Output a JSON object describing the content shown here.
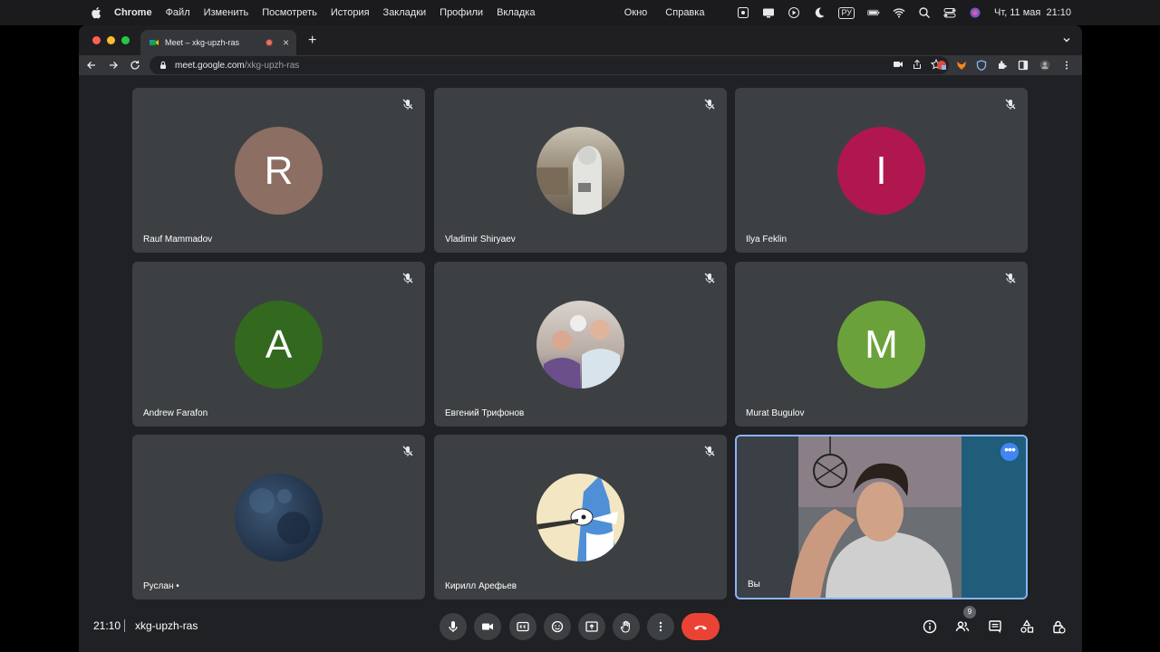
{
  "menubar": {
    "app": "Chrome",
    "items": [
      "Файл",
      "Изменить",
      "Посмотреть",
      "История",
      "Закладки",
      "Профили",
      "Вкладка"
    ],
    "right_items": [
      "Окно",
      "Справка"
    ],
    "keyboard_layout": "РУ",
    "datetime": "Чт, 11 мая  21:10"
  },
  "browser": {
    "tab_title": "Meet – xkg-upzh-ras",
    "url_host": "meet.google.com",
    "url_path": "/xkg-upzh-ras"
  },
  "participants": [
    {
      "name": "Rauf Mammadov",
      "initial": "R",
      "color": "#8d6e63",
      "muted": true
    },
    {
      "name": "Vladimir Shiryaev",
      "initial": "",
      "color": "#8a8478",
      "muted": true
    },
    {
      "name": "Ilya Feklin",
      "initial": "I",
      "color": "#b0174e",
      "muted": true
    },
    {
      "name": "Andrew Farafon",
      "initial": "A",
      "color": "#33691e",
      "muted": true
    },
    {
      "name": "Евгений Трифонов",
      "initial": "",
      "color": "#9a8c84",
      "muted": true
    },
    {
      "name": "Murat Bugulov",
      "initial": "M",
      "color": "#6ba13a",
      "muted": true
    },
    {
      "name": "Руслан •",
      "initial": "",
      "color": "#24364d",
      "muted": true
    },
    {
      "name": "Кирилл Арефьев",
      "initial": "",
      "color": "#f3e6c3",
      "muted": true
    },
    {
      "name": "Вы",
      "initial": "",
      "color": "#5a5e63",
      "muted": false,
      "self": true
    }
  ],
  "bottombar": {
    "time": "21:10",
    "meeting_code": "xkg-upzh-ras",
    "participant_count": "9"
  },
  "colors": {
    "background": "#202124",
    "tile": "#3c4043",
    "end_call": "#ea4335",
    "accent": "#8ab4f8"
  }
}
